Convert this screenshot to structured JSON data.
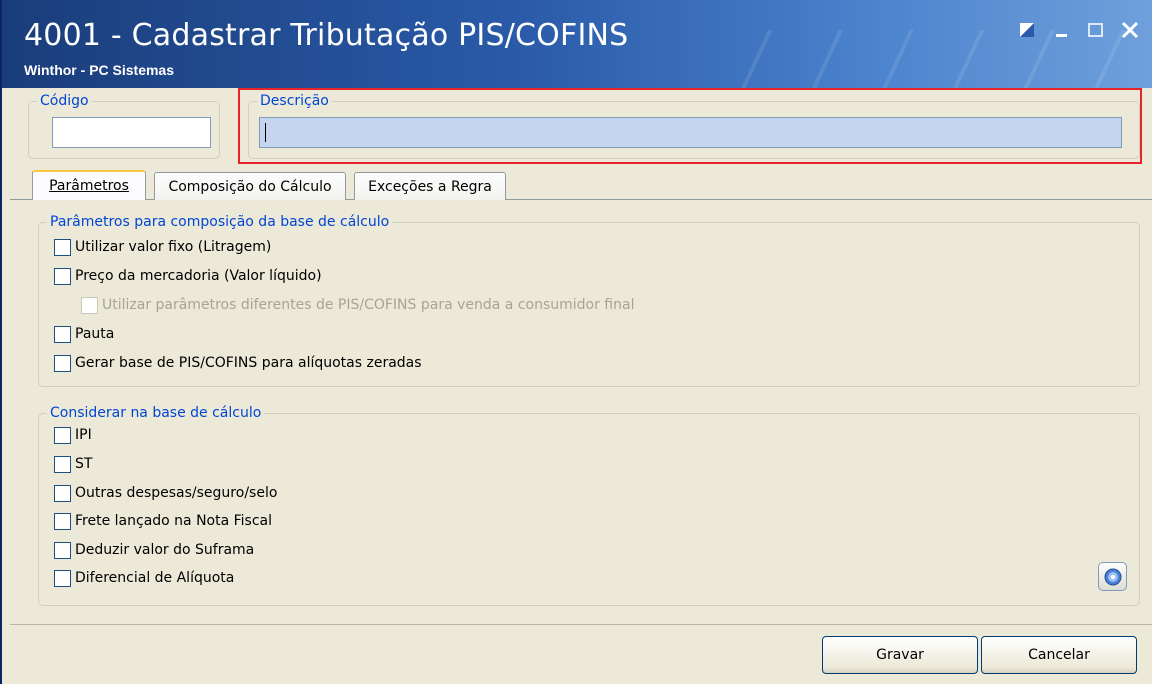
{
  "window": {
    "title": "4001 - Cadastrar Tributação PIS/COFINS",
    "subtitle": "Winthor - PC Sistemas"
  },
  "header": {
    "codigo_label": "Código",
    "codigo_value": "",
    "descricao_label": "Descrição",
    "descricao_value": ""
  },
  "tabs": [
    {
      "label": "Parâmetros",
      "active": true
    },
    {
      "label": "Composição do Cálculo",
      "active": false
    },
    {
      "label": "Exceções a Regra",
      "active": false
    }
  ],
  "params_group": {
    "legend": "Parâmetros para composição da base de cálculo",
    "options": [
      {
        "label": "Utilizar valor fixo (Litragem)",
        "checked": false,
        "enabled": true
      },
      {
        "label": "Preço da mercadoria (Valor líquido)",
        "checked": false,
        "enabled": true
      },
      {
        "label": "Utilizar parâmetros diferentes de PIS/COFINS para venda a consumidor final",
        "checked": false,
        "enabled": false
      },
      {
        "label": "Pauta",
        "checked": false,
        "enabled": true
      },
      {
        "label": "Gerar base de PIS/COFINS para alíquotas zeradas",
        "checked": false,
        "enabled": true
      }
    ]
  },
  "base_group": {
    "legend": "Considerar na base de cálculo",
    "options": [
      {
        "label": "IPI",
        "checked": false
      },
      {
        "label": "ST",
        "checked": false
      },
      {
        "label": "Outras despesas/seguro/selo",
        "checked": false
      },
      {
        "label": "Frete lançado na Nota Fiscal",
        "checked": false
      },
      {
        "label": "Deduzir valor do Suframa",
        "checked": false
      },
      {
        "label": "Diferencial de Alíquota",
        "checked": false
      }
    ]
  },
  "buttons": {
    "gravar": "Gravar",
    "cancelar": "Cancelar"
  },
  "colors": {
    "highlight": "#e8242a",
    "legend": "#0046d5",
    "title_bar": "#2a5aa8"
  }
}
